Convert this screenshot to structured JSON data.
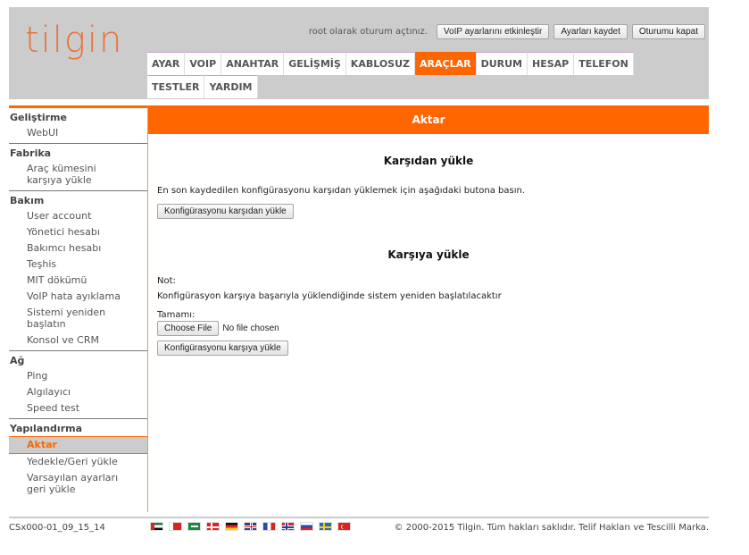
{
  "header": {
    "logo": "tilgin",
    "login_text": "root olarak oturum açtınız.",
    "buttons": {
      "enable_voip": "VoIP ayarlarını etkinleştir",
      "save_settings": "Ayarları kaydet",
      "logout": "Oturumu kapat"
    },
    "tabs": [
      {
        "label": "AYAR",
        "active": false
      },
      {
        "label": "VOIP",
        "active": false
      },
      {
        "label": "ANAHTAR",
        "active": false
      },
      {
        "label": "GELİŞMİŞ",
        "active": false
      },
      {
        "label": "KABLOSUZ",
        "active": false
      },
      {
        "label": "ARAÇLAR",
        "active": true
      },
      {
        "label": "DURUM",
        "active": false
      },
      {
        "label": "HESAP",
        "active": false
      },
      {
        "label": "TELEFON",
        "active": false
      },
      {
        "label": "TESTLER",
        "active": false
      },
      {
        "label": "YARDIM",
        "active": false
      }
    ]
  },
  "sidebar": {
    "groups": [
      {
        "title": "Geliştirme",
        "items": [
          {
            "label": "WebUI"
          }
        ]
      },
      {
        "title": "Fabrika",
        "items": [
          {
            "label": "Araç kümesini karşıya yükle"
          }
        ]
      },
      {
        "title": "Bakım",
        "items": [
          {
            "label": "User account"
          },
          {
            "label": "Yönetici hesabı"
          },
          {
            "label": "Bakımcı hesabı"
          },
          {
            "label": "Teşhis"
          },
          {
            "label": "MIT dökümü"
          },
          {
            "label": "VoIP hata ayıklama"
          },
          {
            "label": "Sistemi yeniden başlatın"
          },
          {
            "label": "Konsol ve CRM"
          }
        ]
      },
      {
        "title": "Ağ",
        "items": [
          {
            "label": "Ping"
          },
          {
            "label": "Algılayıcı"
          },
          {
            "label": "Speed test"
          }
        ]
      },
      {
        "title": "Yapılandırma",
        "items": [
          {
            "label": "Aktar",
            "active": true
          },
          {
            "label": "Yedekle/Geri yükle"
          },
          {
            "label": "Varsayılan ayarları geri yükle"
          }
        ]
      }
    ]
  },
  "main": {
    "title": "Aktar",
    "download": {
      "title": "Karşıdan yükle",
      "description": "En son kaydedilen konfigürasyonu karşıdan yüklemek için aşağıdaki butona basın.",
      "button": "Konfigürasyonu karşıdan yükle"
    },
    "upload": {
      "title": "Karşıya yükle",
      "note_label": "Not:",
      "note_text": "Konfigürasyon karşıya başarıyla yüklendiğinde sistem yeniden başlatılacaktır",
      "file_label": "Tamamı:",
      "choose_file": "Choose File",
      "file_status": "No file chosen",
      "button": "Konfigürasyonu karşıya yükle"
    }
  },
  "footer": {
    "version": "CSx000-01_09_15_14",
    "copyright": "© 2000-2015 Tilgin. Tüm hakları saklıdır. Telif Hakları ve Tescilli Marka.",
    "flags": [
      "uae-flag",
      "bahrain-flag",
      "saudi-flag",
      "denmark-flag",
      "germany-flag",
      "uk-flag",
      "france-flag",
      "norway-flag",
      "russia-flag",
      "sweden-flag",
      "turkey-flag"
    ]
  },
  "colors": {
    "accent": "#ff6600",
    "header_bg": "#cccccc",
    "logo": "#e8733a"
  }
}
